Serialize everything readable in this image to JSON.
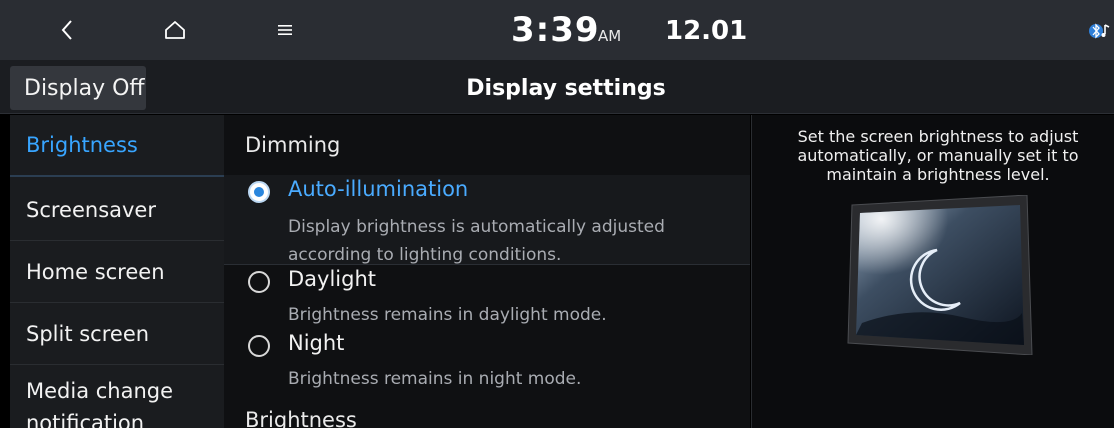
{
  "status_bar": {
    "time": "3:39",
    "ampm": "AM",
    "date": "12.01",
    "icons": [
      "back-icon",
      "home-icon",
      "menu-icon",
      "bluetooth-audio-icon"
    ]
  },
  "header": {
    "display_off_label": "Display Off",
    "title": "Display settings"
  },
  "sidebar": {
    "items": [
      {
        "label": "Brightness",
        "active": true
      },
      {
        "label": "Screensaver"
      },
      {
        "label": "Home screen"
      },
      {
        "label": "Split screen"
      },
      {
        "label": "Media change notification"
      }
    ]
  },
  "content": {
    "dimming_title": "Dimming",
    "options": [
      {
        "label": "Auto-illumination",
        "desc": "Display brightness is automatically adjusted according to lighting conditions.",
        "selected": true
      },
      {
        "label": "Daylight",
        "desc": "Brightness remains in daylight mode."
      },
      {
        "label": "Night",
        "desc": "Brightness remains in night mode."
      }
    ],
    "brightness_title": "Brightness"
  },
  "help": {
    "text": "Set the screen brightness to adjust automatically, or manually set it to maintain a brightness level."
  },
  "colors": {
    "accent": "#38a5ff",
    "statusbar_bg": "#2a2d33",
    "background": "#0f1012"
  }
}
